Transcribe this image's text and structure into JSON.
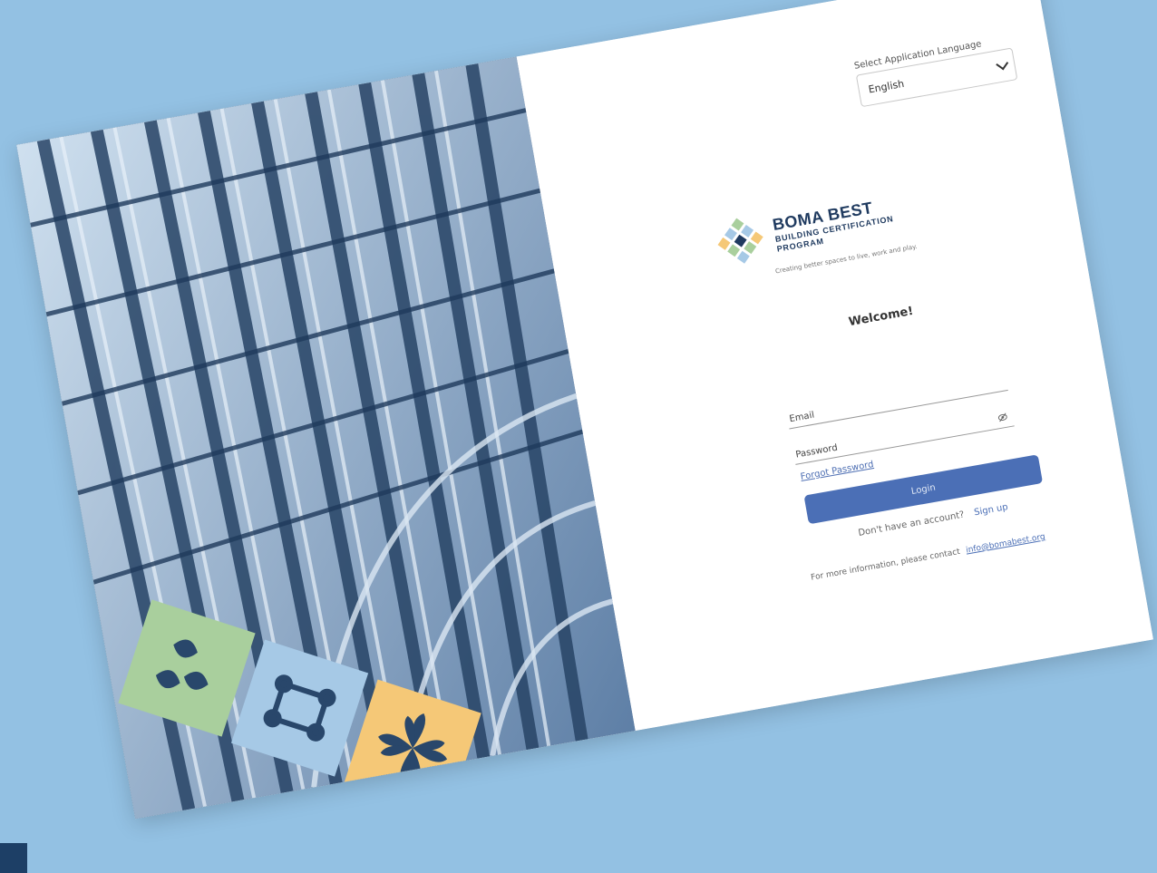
{
  "language": {
    "label": "Select Application Language",
    "selected": "English"
  },
  "brand": {
    "title": "BOMA BEST",
    "subtitle_line1": "BUILDING CERTIFICATION",
    "subtitle_line2": "PROGRAM",
    "tagline": "Creating better spaces to live, work and play."
  },
  "form": {
    "welcome": "Welcome!",
    "email_label": "Email",
    "password_label": "Password",
    "forgot_label": "Forgot Password",
    "login_label": "Login",
    "no_account_text": "Don't have an account?",
    "signup_label": "Sign up",
    "contact_text": "For more information, please contact",
    "contact_email": "info@bomabest.org"
  },
  "colors": {
    "background": "#93c1e3",
    "primary_button": "#4b6fb6",
    "brand_navy": "#1f3a5f",
    "tile_green": "#a9cf9d",
    "tile_blue": "#a6c9e6",
    "tile_yellow": "#f5c877"
  },
  "icons": {
    "select_arrow": "chevron-down-icon",
    "password_toggle": "eye-off-icon",
    "logo": "boma-logo-icon",
    "tiles": [
      "leaf-icon",
      "network-icon",
      "fan-icon"
    ]
  }
}
